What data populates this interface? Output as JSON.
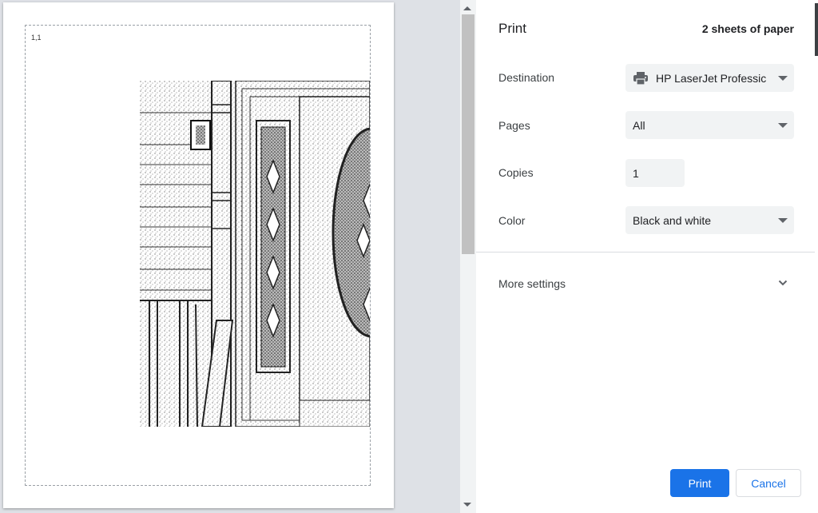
{
  "preview": {
    "page_label": "1,1"
  },
  "panel": {
    "title": "Print",
    "sheets": "2 sheets of paper",
    "destination": {
      "label": "Destination",
      "value": "HP LaserJet Professic",
      "icon": "printer-icon"
    },
    "pages": {
      "label": "Pages",
      "value": "All"
    },
    "copies": {
      "label": "Copies",
      "value": "1"
    },
    "color": {
      "label": "Color",
      "value": "Black and white"
    },
    "more_settings": {
      "label": "More settings",
      "icon": "chevron-down-icon"
    }
  },
  "buttons": {
    "print": "Print",
    "cancel": "Cancel"
  },
  "colors": {
    "accent": "#1a73e8",
    "field_bg": "#f1f3f4",
    "backdrop": "#dee1e6"
  }
}
